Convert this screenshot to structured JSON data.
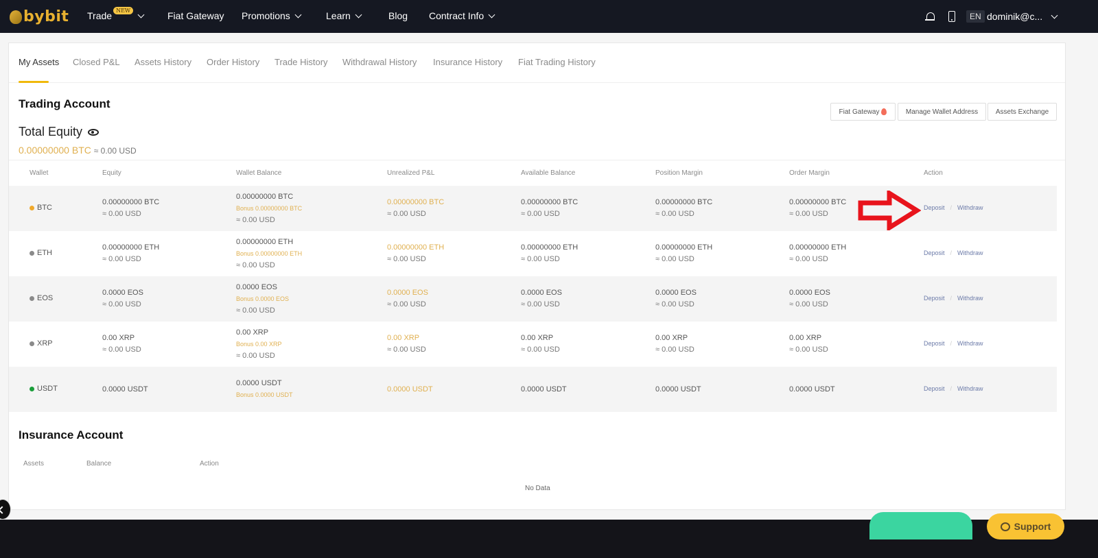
{
  "nav": {
    "brand": "bybit",
    "items": [
      {
        "label": "Trade",
        "badge": "NEW",
        "dropdown": true
      },
      {
        "label": "Fiat Gateway",
        "dropdown": false
      },
      {
        "label": "Promotions",
        "dropdown": true
      },
      {
        "label": "Learn",
        "dropdown": true
      },
      {
        "label": "Blog",
        "dropdown": false
      },
      {
        "label": "Contract Info",
        "dropdown": true
      }
    ],
    "icons": [
      "bell-icon",
      "mobile-icon"
    ],
    "language": "EN",
    "user": "dominik@c..."
  },
  "tabs": [
    {
      "label": "My Assets",
      "active": true
    },
    {
      "label": "Closed P&L"
    },
    {
      "label": "Assets History"
    },
    {
      "label": "Order History"
    },
    {
      "label": "Trade History"
    },
    {
      "label": "Withdrawal History"
    },
    {
      "label": "Insurance History"
    },
    {
      "label": "Fiat Trading History"
    }
  ],
  "trading_account": {
    "title": "Trading Account",
    "total_equity_label": "Total Equity",
    "total_equity_btc": "0.00000000 BTC",
    "total_equity_usd": "≈ 0.00 USD",
    "buttons": {
      "fiat_gateway": "Fiat Gateway",
      "manage_wallet": "Manage Wallet Address",
      "assets_exchange": "Assets Exchange"
    },
    "columns": [
      "Wallet",
      "Equity",
      "Wallet Balance",
      "Unrealized P&L",
      "Available Balance",
      "Position Margin",
      "Order Margin",
      "Action"
    ],
    "rows": [
      {
        "coin": "BTC",
        "dot_color": "#f0a92c",
        "equity": "0.00000000 BTC",
        "equity_usd": "≈ 0.00 USD",
        "wallet": "0.00000000 BTC",
        "wallet_bonus": "Bonus 0.00000000 BTC",
        "wallet_usd": "≈ 0.00 USD",
        "upnl": "0.00000000 BTC",
        "upnl_usd": "≈ 0.00 USD",
        "avail": "0.00000000 BTC",
        "avail_usd": "≈ 0.00 USD",
        "pos": "0.00000000 BTC",
        "pos_usd": "≈ 0.00 USD",
        "order": "0.00000000 BTC",
        "order_usd": "≈ 0.00 USD",
        "deposit": "Deposit",
        "withdraw": "Withdraw"
      },
      {
        "coin": "ETH",
        "dot_color": "#8a8a8a",
        "equity": "0.00000000 ETH",
        "equity_usd": "≈ 0.00 USD",
        "wallet": "0.00000000 ETH",
        "wallet_bonus": "Bonus 0.00000000 ETH",
        "wallet_usd": "≈ 0.00 USD",
        "upnl": "0.00000000 ETH",
        "upnl_usd": "≈ 0.00 USD",
        "avail": "0.00000000 ETH",
        "avail_usd": "≈ 0.00 USD",
        "pos": "0.00000000 ETH",
        "pos_usd": "≈ 0.00 USD",
        "order": "0.00000000 ETH",
        "order_usd": "≈ 0.00 USD",
        "deposit": "Deposit",
        "withdraw": "Withdraw"
      },
      {
        "coin": "EOS",
        "dot_color": "#8a8a8a",
        "equity": "0.0000 EOS",
        "equity_usd": "≈ 0.00 USD",
        "wallet": "0.0000 EOS",
        "wallet_bonus": "Bonus 0.0000 EOS",
        "wallet_usd": "≈ 0.00 USD",
        "upnl": "0.0000 EOS",
        "upnl_usd": "≈ 0.00 USD",
        "avail": "0.0000 EOS",
        "avail_usd": "≈ 0.00 USD",
        "pos": "0.0000 EOS",
        "pos_usd": "≈ 0.00 USD",
        "order": "0.0000 EOS",
        "order_usd": "≈ 0.00 USD",
        "deposit": "Deposit",
        "withdraw": "Withdraw"
      },
      {
        "coin": "XRP",
        "dot_color": "#8a8a8a",
        "equity": "0.00 XRP",
        "equity_usd": "≈ 0.00 USD",
        "wallet": "0.00 XRP",
        "wallet_bonus": "Bonus 0.00 XRP",
        "wallet_usd": "≈ 0.00 USD",
        "upnl": "0.00 XRP",
        "upnl_usd": "≈ 0.00 USD",
        "avail": "0.00 XRP",
        "avail_usd": "≈ 0.00 USD",
        "pos": "0.00 XRP",
        "pos_usd": "≈ 0.00 USD",
        "order": "0.00 XRP",
        "order_usd": "≈ 0.00 USD",
        "deposit": "Deposit",
        "withdraw": "Withdraw"
      },
      {
        "coin": "USDT",
        "dot_color": "#1a9e3a",
        "equity": "0.0000 USDT",
        "equity_usd": null,
        "wallet": "0.0000 USDT",
        "wallet_bonus": "Bonus 0.0000 USDT",
        "wallet_usd": null,
        "upnl": "0.0000 USDT",
        "upnl_usd": null,
        "avail": "0.0000 USDT",
        "avail_usd": null,
        "pos": "0.0000 USDT",
        "pos_usd": null,
        "order": "0.0000 USDT",
        "order_usd": null,
        "deposit": "Deposit",
        "withdraw": "Withdraw"
      }
    ]
  },
  "insurance_account": {
    "title": "Insurance Account",
    "columns": [
      "Assets",
      "Balance",
      "Action"
    ],
    "empty": "No Data"
  },
  "support_label": "Support",
  "colors": {
    "nav_bg": "#151822",
    "accent": "#f0b90b",
    "gold_text": "#e0b050",
    "link": "#6b7aa8",
    "support": "#f9c233",
    "annotation_arrow": "#e8141c"
  }
}
